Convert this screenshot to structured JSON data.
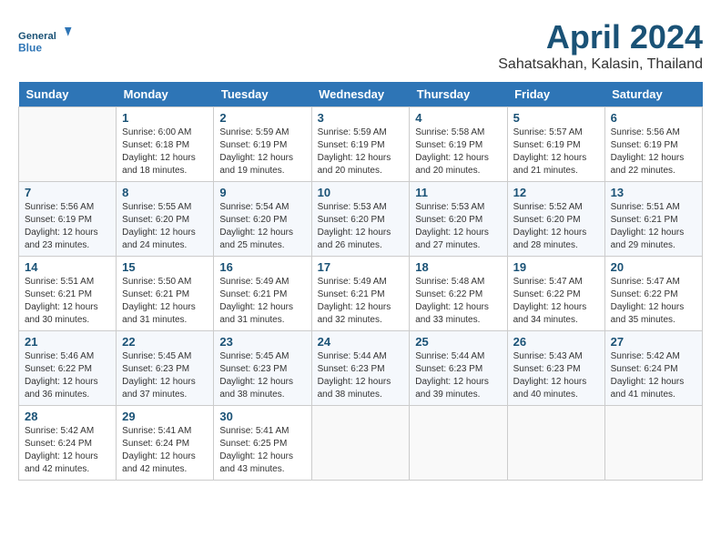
{
  "header": {
    "logo_line1": "General",
    "logo_line2": "Blue",
    "title": "April 2024",
    "subtitle": "Sahatsakhan, Kalasin, Thailand"
  },
  "days_of_week": [
    "Sunday",
    "Monday",
    "Tuesday",
    "Wednesday",
    "Thursday",
    "Friday",
    "Saturday"
  ],
  "weeks": [
    [
      {
        "day": "",
        "info": ""
      },
      {
        "day": "1",
        "info": "Sunrise: 6:00 AM\nSunset: 6:18 PM\nDaylight: 12 hours\nand 18 minutes."
      },
      {
        "day": "2",
        "info": "Sunrise: 5:59 AM\nSunset: 6:19 PM\nDaylight: 12 hours\nand 19 minutes."
      },
      {
        "day": "3",
        "info": "Sunrise: 5:59 AM\nSunset: 6:19 PM\nDaylight: 12 hours\nand 20 minutes."
      },
      {
        "day": "4",
        "info": "Sunrise: 5:58 AM\nSunset: 6:19 PM\nDaylight: 12 hours\nand 20 minutes."
      },
      {
        "day": "5",
        "info": "Sunrise: 5:57 AM\nSunset: 6:19 PM\nDaylight: 12 hours\nand 21 minutes."
      },
      {
        "day": "6",
        "info": "Sunrise: 5:56 AM\nSunset: 6:19 PM\nDaylight: 12 hours\nand 22 minutes."
      }
    ],
    [
      {
        "day": "7",
        "info": "Sunrise: 5:56 AM\nSunset: 6:19 PM\nDaylight: 12 hours\nand 23 minutes."
      },
      {
        "day": "8",
        "info": "Sunrise: 5:55 AM\nSunset: 6:20 PM\nDaylight: 12 hours\nand 24 minutes."
      },
      {
        "day": "9",
        "info": "Sunrise: 5:54 AM\nSunset: 6:20 PM\nDaylight: 12 hours\nand 25 minutes."
      },
      {
        "day": "10",
        "info": "Sunrise: 5:53 AM\nSunset: 6:20 PM\nDaylight: 12 hours\nand 26 minutes."
      },
      {
        "day": "11",
        "info": "Sunrise: 5:53 AM\nSunset: 6:20 PM\nDaylight: 12 hours\nand 27 minutes."
      },
      {
        "day": "12",
        "info": "Sunrise: 5:52 AM\nSunset: 6:20 PM\nDaylight: 12 hours\nand 28 minutes."
      },
      {
        "day": "13",
        "info": "Sunrise: 5:51 AM\nSunset: 6:21 PM\nDaylight: 12 hours\nand 29 minutes."
      }
    ],
    [
      {
        "day": "14",
        "info": "Sunrise: 5:51 AM\nSunset: 6:21 PM\nDaylight: 12 hours\nand 30 minutes."
      },
      {
        "day": "15",
        "info": "Sunrise: 5:50 AM\nSunset: 6:21 PM\nDaylight: 12 hours\nand 31 minutes."
      },
      {
        "day": "16",
        "info": "Sunrise: 5:49 AM\nSunset: 6:21 PM\nDaylight: 12 hours\nand 31 minutes."
      },
      {
        "day": "17",
        "info": "Sunrise: 5:49 AM\nSunset: 6:21 PM\nDaylight: 12 hours\nand 32 minutes."
      },
      {
        "day": "18",
        "info": "Sunrise: 5:48 AM\nSunset: 6:22 PM\nDaylight: 12 hours\nand 33 minutes."
      },
      {
        "day": "19",
        "info": "Sunrise: 5:47 AM\nSunset: 6:22 PM\nDaylight: 12 hours\nand 34 minutes."
      },
      {
        "day": "20",
        "info": "Sunrise: 5:47 AM\nSunset: 6:22 PM\nDaylight: 12 hours\nand 35 minutes."
      }
    ],
    [
      {
        "day": "21",
        "info": "Sunrise: 5:46 AM\nSunset: 6:22 PM\nDaylight: 12 hours\nand 36 minutes."
      },
      {
        "day": "22",
        "info": "Sunrise: 5:45 AM\nSunset: 6:23 PM\nDaylight: 12 hours\nand 37 minutes."
      },
      {
        "day": "23",
        "info": "Sunrise: 5:45 AM\nSunset: 6:23 PM\nDaylight: 12 hours\nand 38 minutes."
      },
      {
        "day": "24",
        "info": "Sunrise: 5:44 AM\nSunset: 6:23 PM\nDaylight: 12 hours\nand 38 minutes."
      },
      {
        "day": "25",
        "info": "Sunrise: 5:44 AM\nSunset: 6:23 PM\nDaylight: 12 hours\nand 39 minutes."
      },
      {
        "day": "26",
        "info": "Sunrise: 5:43 AM\nSunset: 6:23 PM\nDaylight: 12 hours\nand 40 minutes."
      },
      {
        "day": "27",
        "info": "Sunrise: 5:42 AM\nSunset: 6:24 PM\nDaylight: 12 hours\nand 41 minutes."
      }
    ],
    [
      {
        "day": "28",
        "info": "Sunrise: 5:42 AM\nSunset: 6:24 PM\nDaylight: 12 hours\nand 42 minutes."
      },
      {
        "day": "29",
        "info": "Sunrise: 5:41 AM\nSunset: 6:24 PM\nDaylight: 12 hours\nand 42 minutes."
      },
      {
        "day": "30",
        "info": "Sunrise: 5:41 AM\nSunset: 6:25 PM\nDaylight: 12 hours\nand 43 minutes."
      },
      {
        "day": "",
        "info": ""
      },
      {
        "day": "",
        "info": ""
      },
      {
        "day": "",
        "info": ""
      },
      {
        "day": "",
        "info": ""
      }
    ]
  ]
}
